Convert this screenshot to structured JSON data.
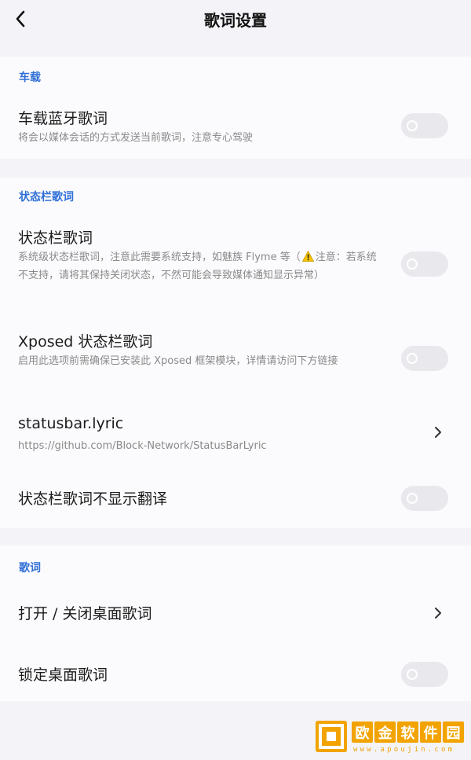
{
  "header": {
    "title": "歌词设置"
  },
  "sections": [
    {
      "label": "车载",
      "rows": [
        {
          "title": "车载蓝牙歌词",
          "subtitle": "将会以媒体会话的方式发送当前歌词，注意专心驾驶",
          "control": "toggle",
          "enabled": false
        }
      ]
    },
    {
      "label": "状态栏歌词",
      "rows": [
        {
          "title": "状态栏歌词",
          "subtitle_before_icon": "系统级状态栏歌词，注意此需要系统支持，如魅族 Flyme 等（",
          "subtitle_icon": "warning-icon",
          "subtitle_after_icon": "注意：若系统不支持，请将其保持关闭状态，不然可能会导致媒体通知显示异常）",
          "control": "toggle",
          "enabled": false
        },
        {
          "title": "Xposed 状态栏歌词",
          "subtitle": "启用此选项前需确保已安装此 Xposed 框架模块，详情请访问下方链接",
          "control": "toggle",
          "enabled": false
        },
        {
          "title": "statusbar.lyric",
          "subtitle": "https://github.com/Block-Network/StatusBarLyric",
          "control": "chevron"
        },
        {
          "title": "状态栏歌词不显示翻译",
          "control": "toggle",
          "enabled": false
        }
      ]
    },
    {
      "label": "歌词",
      "rows": [
        {
          "title": "打开 / 关闭桌面歌词",
          "control": "chevron"
        },
        {
          "title": "锁定桌面歌词",
          "control": "toggle",
          "enabled": false
        }
      ]
    }
  ],
  "watermark": {
    "chars": [
      "欧",
      "金",
      "软",
      "件",
      "园"
    ],
    "url": "www.apoujin.com",
    "color": "#f2a300"
  },
  "colors": {
    "accent": "#2f6fd6",
    "background": "#f3f3f8",
    "card": "#fbfbfd",
    "toggle_off": "#e9e9ed"
  }
}
